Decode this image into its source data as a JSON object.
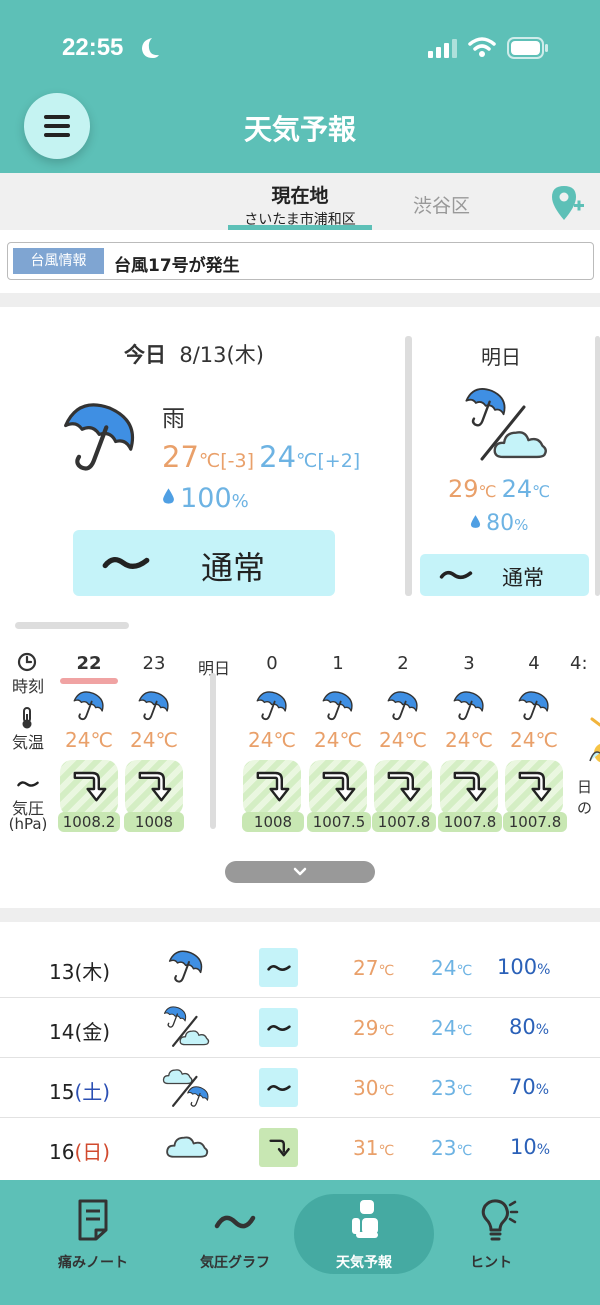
{
  "status": {
    "time": "22:55"
  },
  "header": {
    "title": "天気予報"
  },
  "locations": {
    "current_label": "現在地",
    "current_sub": "さいたま市浦和区",
    "other": "渋谷区"
  },
  "alert": {
    "badge": "台風情報",
    "text": "台風17号が発生"
  },
  "today": {
    "label": "今日",
    "date": "8/13(木)",
    "condition": "雨",
    "high": "27",
    "high_diff": "[-3]",
    "low": "24",
    "low_diff": "[+2]",
    "rain": "100",
    "rain_unit": "%",
    "pain_symbol": "〜",
    "pain_label": "通常"
  },
  "tomorrow": {
    "label": "明日",
    "high": "29",
    "low": "24",
    "rain": "80",
    "rain_unit": "%",
    "pain_symbol": "〜",
    "pain_label": "通常"
  },
  "units": {
    "temp": "℃"
  },
  "hourly": {
    "labels": {
      "time": "時刻",
      "temp": "気温",
      "pressure": "気圧",
      "pressure_unit": "(hPa)",
      "sun": "日の"
    },
    "hours": [
      "22",
      "23",
      "明日",
      "0",
      "1",
      "2",
      "3",
      "4",
      "4:"
    ],
    "temps": [
      "24℃",
      "24℃",
      "24℃",
      "24℃",
      "24℃",
      "24℃",
      "24℃"
    ],
    "pressures": [
      "1008.2",
      "1008",
      "1008",
      "1007.5",
      "1007.8",
      "1007.8",
      "1007.8"
    ]
  },
  "daily": [
    {
      "day": "13",
      "weekday": "(木)",
      "pain": "〜",
      "high": "27",
      "low": "24",
      "rain": "100"
    },
    {
      "day": "14",
      "weekday": "(金)",
      "pain": "〜",
      "high": "29",
      "low": "24",
      "rain": "80"
    },
    {
      "day": "15",
      "weekday": "(土)",
      "pain": "〜",
      "high": "30",
      "low": "23",
      "rain": "70"
    },
    {
      "day": "16",
      "weekday": "(日)",
      "pain": "",
      "high": "31",
      "low": "23",
      "rain": "10"
    }
  ],
  "nav": {
    "notes": "痛みノート",
    "graph": "気圧グラフ",
    "forecast": "天気予報",
    "hints": "ヒント"
  },
  "colors": {
    "brand": "#5dc0b7",
    "high_temp": "#e9a06a",
    "low_temp": "#6db3e3",
    "rain": "#2b61b8",
    "pain_normal_bg": "#c5f3f9",
    "pain_drop_bg": "#c8e7b3"
  }
}
